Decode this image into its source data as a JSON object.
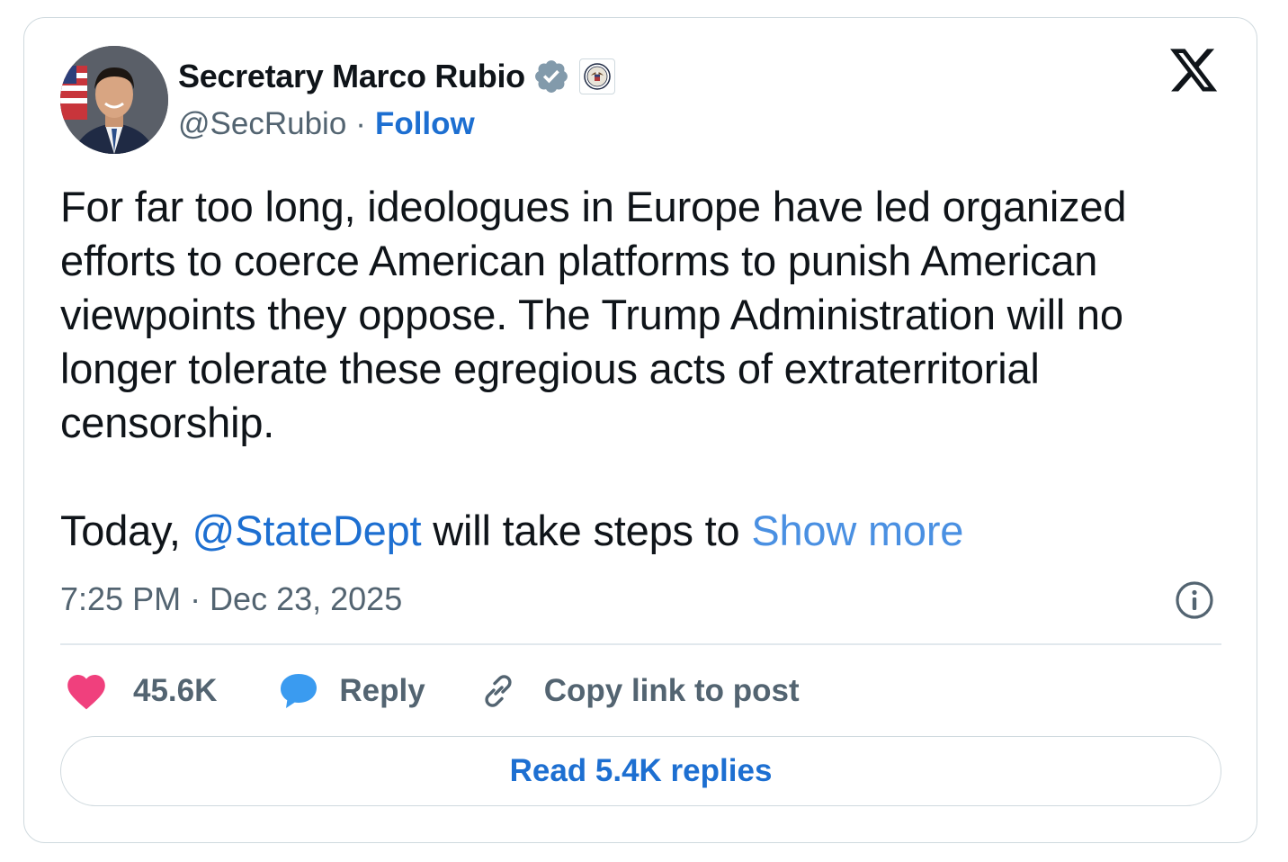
{
  "author": {
    "display_name": "Secretary Marco Rubio",
    "handle": "@SecRubio",
    "separator": "·",
    "follow_label": "Follow",
    "verified_badge_color": "#829aab"
  },
  "post": {
    "text_paragraph_1": "For far too long, ideologues in Europe have led organized efforts to coerce American platforms to punish American viewpoints they oppose. The Trump Administration will no longer tolerate these egregious acts of extraterritorial censorship.",
    "text_p2_before": "Today, ",
    "mention": "@StateDept",
    "text_p2_after": " will take steps to ",
    "show_more_label": "Show more",
    "timestamp": "7:25 PM · Dec 23, 2025"
  },
  "actions": {
    "like_count": "45.6K",
    "reply_label": "Reply",
    "copy_link_label": "Copy link to post",
    "read_replies_label": "Read 5.4K replies"
  },
  "colors": {
    "accent": "#1d6fd1",
    "show_more": "#4a90e2",
    "like_heart": "#f0407d",
    "reply_bubble": "#3a9bf0",
    "secondary_text": "#536471",
    "primary_text": "#0f1419",
    "border": "#cfd9de"
  },
  "icons": {
    "avatar": "profile-photo",
    "verified": "verified-badge-icon",
    "affiliate": "state-department-seal-icon",
    "platform": "x-logo-icon",
    "info": "info-icon",
    "like": "heart-icon",
    "reply": "speech-bubble-icon",
    "copy_link": "link-icon"
  }
}
